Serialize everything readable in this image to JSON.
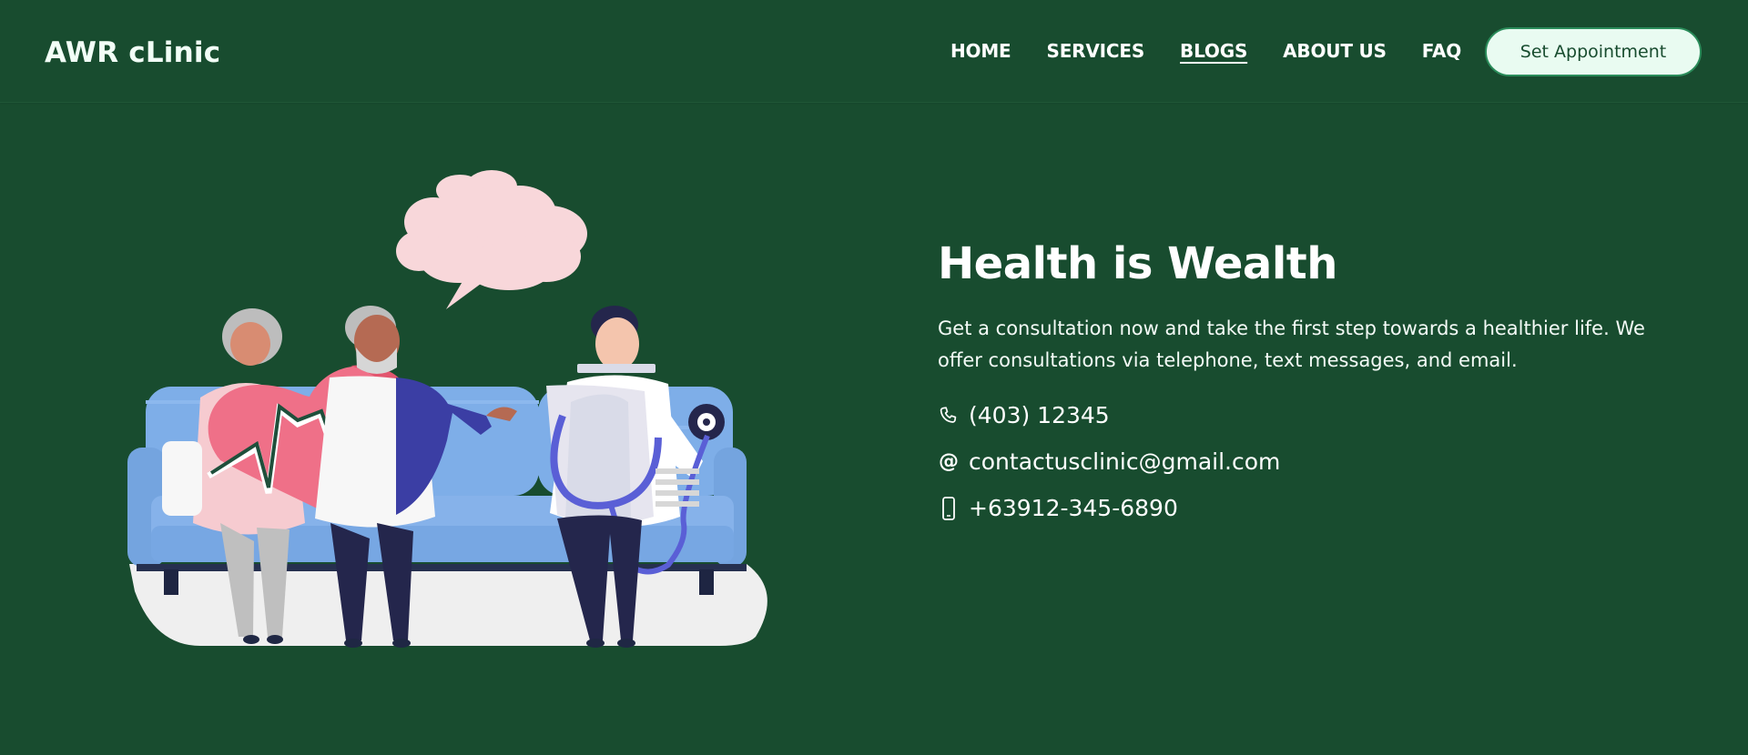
{
  "brand": {
    "name": "AWR cLinic"
  },
  "nav": {
    "items": [
      {
        "label": "HOME",
        "active": false
      },
      {
        "label": "SERVICES",
        "active": false
      },
      {
        "label": "BLOGS",
        "active": true
      },
      {
        "label": "ABOUT US",
        "active": false
      },
      {
        "label": "FAQ",
        "active": false
      }
    ],
    "cta_label": "Set Appointment"
  },
  "hero": {
    "headline": "Health is Wealth",
    "description": "Get a consultation now and take the first step towards a healthier life. We offer consultations via telephone, text messages, and email.",
    "contacts": {
      "phone": "(403) 12345",
      "email": "contactusclinic@gmail.com",
      "mobile": "+63912-345-6890"
    }
  },
  "icons": {
    "phone": "phone-icon",
    "email": "at-icon",
    "mobile": "mobile-icon"
  },
  "colors": {
    "background": "#184c2f",
    "button_bg": "#e9fbf1",
    "button_border": "#2a8c5a",
    "text": "#ffffff"
  }
}
